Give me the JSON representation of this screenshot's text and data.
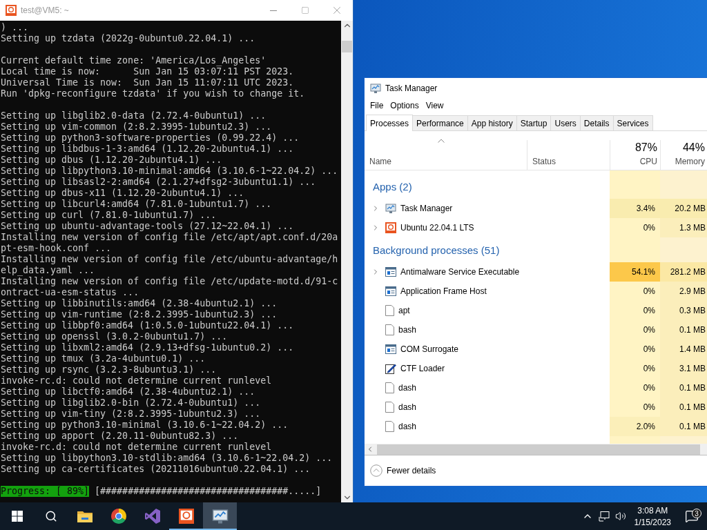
{
  "terminal": {
    "title": "test@VM5: ~",
    "active": false,
    "blocks": [
      [
        ") ...",
        "Setting up tzdata (2022g-0ubuntu0.22.04.1) ..."
      ],
      [
        "Current default time zone: 'America/Los_Angeles'",
        "Local time is now:      Sun Jan 15 03:07:11 PST 2023.",
        "Universal Time is now:  Sun Jan 15 11:07:11 UTC 2023.",
        "Run 'dpkg-reconfigure tzdata' if you wish to change it."
      ],
      [
        "Setting up libglib2.0-data (2.72.4-0ubuntu1) ...",
        "Setting up vim-common (2:8.2.3995-1ubuntu2.3) ...",
        "Setting up python3-software-properties (0.99.22.4) ...",
        "Setting up libdbus-1-3:amd64 (1.12.20-2ubuntu4.1) ...",
        "Setting up dbus (1.12.20-2ubuntu4.1) ...",
        "Setting up libpython3.10-minimal:amd64 (3.10.6-1~22.04.2) ...",
        "Setting up libsasl2-2:amd64 (2.1.27+dfsg2-3ubuntu1.1) ...",
        "Setting up dbus-x11 (1.12.20-2ubuntu4.1) ...",
        "Setting up libcurl4:amd64 (7.81.0-1ubuntu1.7) ...",
        "Setting up curl (7.81.0-1ubuntu1.7) ...",
        "Setting up ubuntu-advantage-tools (27.12~22.04.1) ...",
        "Installing new version of config file /etc/apt/apt.conf.d/20a",
        "pt-esm-hook.conf ...",
        "Installing new version of config file /etc/ubuntu-advantage/h",
        "elp_data.yaml ...",
        "Installing new version of config file /etc/update-motd.d/91-c",
        "ontract-ua-esm-status ...",
        "Setting up libbinutils:amd64 (2.38-4ubuntu2.1) ...",
        "Setting up vim-runtime (2:8.2.3995-1ubuntu2.3) ...",
        "Setting up libbpf0:amd64 (1:0.5.0-1ubuntu22.04.1) ...",
        "Setting up openssl (3.0.2-0ubuntu1.7) ...",
        "Setting up libxml2:amd64 (2.9.13+dfsg-1ubuntu0.2) ...",
        "Setting up tmux (3.2a-4ubuntu0.1) ...",
        "Setting up rsync (3.2.3-8ubuntu3.1) ...",
        "invoke-rc.d: could not determine current runlevel",
        "Setting up libctf0:amd64 (2.38-4ubuntu2.1) ...",
        "Setting up libglib2.0-bin (2.72.4-0ubuntu1) ...",
        "Setting up vim-tiny (2:8.2.3995-1ubuntu2.3) ...",
        "Setting up python3.10-minimal (3.10.6-1~22.04.2) ...",
        "Setting up apport (2.20.11-0ubuntu82.3) ...",
        "invoke-rc.d: could not determine current runlevel",
        "Setting up libpython3.10-stdlib:amd64 (3.10.6-1~22.04.2) ...",
        "Setting up ca-certificates (20211016ubuntu0.22.04.1) ..."
      ]
    ],
    "progress": {
      "label": "Progress: [ 89%]",
      "bar": "[##################################.....]"
    }
  },
  "task_manager": {
    "title": "Task Manager",
    "active": true,
    "menu": [
      "File",
      "Options",
      "View"
    ],
    "tabs": [
      {
        "label": "Processes",
        "selected": true
      },
      {
        "label": "Performance",
        "selected": false
      },
      {
        "label": "App history",
        "selected": false
      },
      {
        "label": "Startup",
        "selected": false
      },
      {
        "label": "Users",
        "selected": false
      },
      {
        "label": "Details",
        "selected": false
      },
      {
        "label": "Services",
        "selected": false
      }
    ],
    "columns": [
      {
        "label": "Name",
        "sorted": true
      },
      {
        "label": "Status",
        "sorted": false
      },
      {
        "label": "CPU",
        "total": "87%",
        "sorted": false
      },
      {
        "label": "Memory",
        "total": "44%",
        "sorted": false
      }
    ],
    "groups": [
      {
        "title": "Apps (2)",
        "processes": [
          {
            "name": "Task Manager",
            "kind": "monitor",
            "expandable": true,
            "cpu": {
              "text": "3.4%",
              "color": "#f9ecaf"
            },
            "memory": {
              "text": "20.2 MB",
              "color": "#f9ecaf"
            }
          },
          {
            "name": "Ubuntu 22.04.1 LTS",
            "kind": "ubuntu",
            "expandable": true,
            "cpu": {
              "text": "0%",
              "color": "#fff4c4"
            },
            "memory": {
              "text": "1.3 MB",
              "color": "#fbeebb"
            }
          }
        ]
      },
      {
        "title": "Background processes (51)",
        "processes": [
          {
            "name": "Antimalware Service Executable",
            "kind": "app",
            "expandable": true,
            "cpu": {
              "text": "54.1%",
              "color": "#fcc84a"
            },
            "memory": {
              "text": "281.2 MB",
              "color": "#fbe8a4"
            }
          },
          {
            "name": "Application Frame Host",
            "kind": "app",
            "expandable": false,
            "cpu": {
              "text": "0%",
              "color": "#fff4c4"
            },
            "memory": {
              "text": "2.9 MB",
              "color": "#fbeebb"
            }
          },
          {
            "name": "apt",
            "kind": "file",
            "expandable": false,
            "cpu": {
              "text": "0%",
              "color": "#fff4c4"
            },
            "memory": {
              "text": "0.3 MB",
              "color": "#fbeebb"
            }
          },
          {
            "name": "bash",
            "kind": "file",
            "expandable": false,
            "cpu": {
              "text": "0%",
              "color": "#fff4c4"
            },
            "memory": {
              "text": "0.1 MB",
              "color": "#fbeebb"
            }
          },
          {
            "name": "COM Surrogate",
            "kind": "app",
            "expandable": false,
            "cpu": {
              "text": "0%",
              "color": "#fff4c4"
            },
            "memory": {
              "text": "1.4 MB",
              "color": "#fbeebb"
            }
          },
          {
            "name": "CTF Loader",
            "kind": "pen",
            "expandable": false,
            "cpu": {
              "text": "0%",
              "color": "#fff4c4"
            },
            "memory": {
              "text": "3.1 MB",
              "color": "#fbeebb"
            }
          },
          {
            "name": "dash",
            "kind": "file",
            "expandable": false,
            "cpu": {
              "text": "0%",
              "color": "#fff4c4"
            },
            "memory": {
              "text": "0.1 MB",
              "color": "#fbeebb"
            }
          },
          {
            "name": "dash",
            "kind": "file",
            "expandable": false,
            "cpu": {
              "text": "0%",
              "color": "#fff4c4"
            },
            "memory": {
              "text": "0.1 MB",
              "color": "#fbeebb"
            }
          },
          {
            "name": "dash",
            "kind": "file",
            "expandable": false,
            "cpu": {
              "text": "2.0%",
              "color": "#fbefb9"
            },
            "memory": {
              "text": "0.1 MB",
              "color": "#fbeebb"
            }
          }
        ]
      }
    ],
    "footer": "Fewer details"
  },
  "taskbar": {
    "items": [
      {
        "kind": "start",
        "running": false,
        "selected": false
      },
      {
        "kind": "search",
        "running": false,
        "selected": false
      },
      {
        "kind": "folder",
        "running": false,
        "selected": false
      },
      {
        "kind": "browser",
        "running": false,
        "selected": false
      },
      {
        "kind": "ribbon",
        "running": false,
        "selected": false
      },
      {
        "kind": "ubuntu",
        "running": true,
        "selected": false
      },
      {
        "kind": "monitor",
        "running": true,
        "selected": true
      }
    ],
    "time": "3:08 AM",
    "date": "1/15/2023",
    "notification_count": "3"
  }
}
